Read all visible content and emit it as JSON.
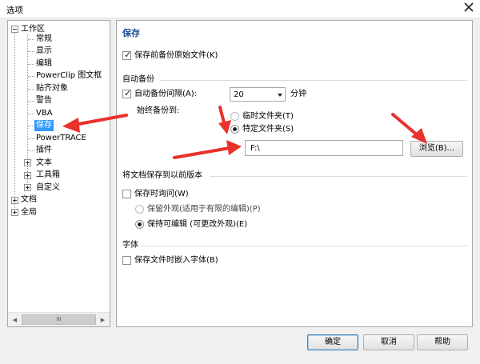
{
  "window": {
    "title": "选项",
    "close_label": "✕"
  },
  "tree": {
    "root_workspace": "工作区",
    "items": [
      "常规",
      "显示",
      "编辑",
      "PowerClip 图文框",
      "贴齐对象",
      "警告",
      "VBA",
      "保存",
      "PowerTRACE",
      "插件",
      "文本",
      "工具箱",
      "自定义"
    ],
    "root_document": "文档",
    "root_global": "全局",
    "selected": "保存"
  },
  "scrollbar": {
    "left_arrow": "◀",
    "right_arrow": "▶",
    "thumb_grip": "III"
  },
  "main": {
    "section_title": "保存",
    "backup_before_save": "保存前备份原始文件(K)",
    "auto_backup_group": "自动备份",
    "auto_backup_interval_label": "自动备份间隔(A):",
    "interval_value": "20",
    "interval_unit": "分钟",
    "always_backup_to": "始终备份到:",
    "temp_folder": "临时文件夹(T)",
    "specific_folder": "特定文件夹(S)",
    "folder_path": "F:\\",
    "browse_button": "浏览(B)...",
    "save_old_version_group": "将文档保存到以前版本",
    "save_appearance_check": "保存时询问(W)",
    "keep_appearance": "保留外观(适用于有限的编辑)(P)",
    "keep_editable": "保持可编辑 (可更改外观)(E)",
    "font_group": "字体",
    "embed_fonts": "保存文件时嵌入字体(B)"
  },
  "footer": {
    "ok": "确定",
    "cancel": "取消",
    "help": "帮助"
  },
  "state": {
    "backup_before_save_checked": true,
    "auto_backup_checked": true,
    "temp_folder_selected": false,
    "specific_folder_selected": true,
    "ask_on_save_checked": false,
    "keep_editable_selected": true,
    "embed_fonts_checked": false
  },
  "colors": {
    "selection": "#3399ff",
    "section_title": "#1f4e99",
    "annotation_arrow": "#e8322b"
  }
}
